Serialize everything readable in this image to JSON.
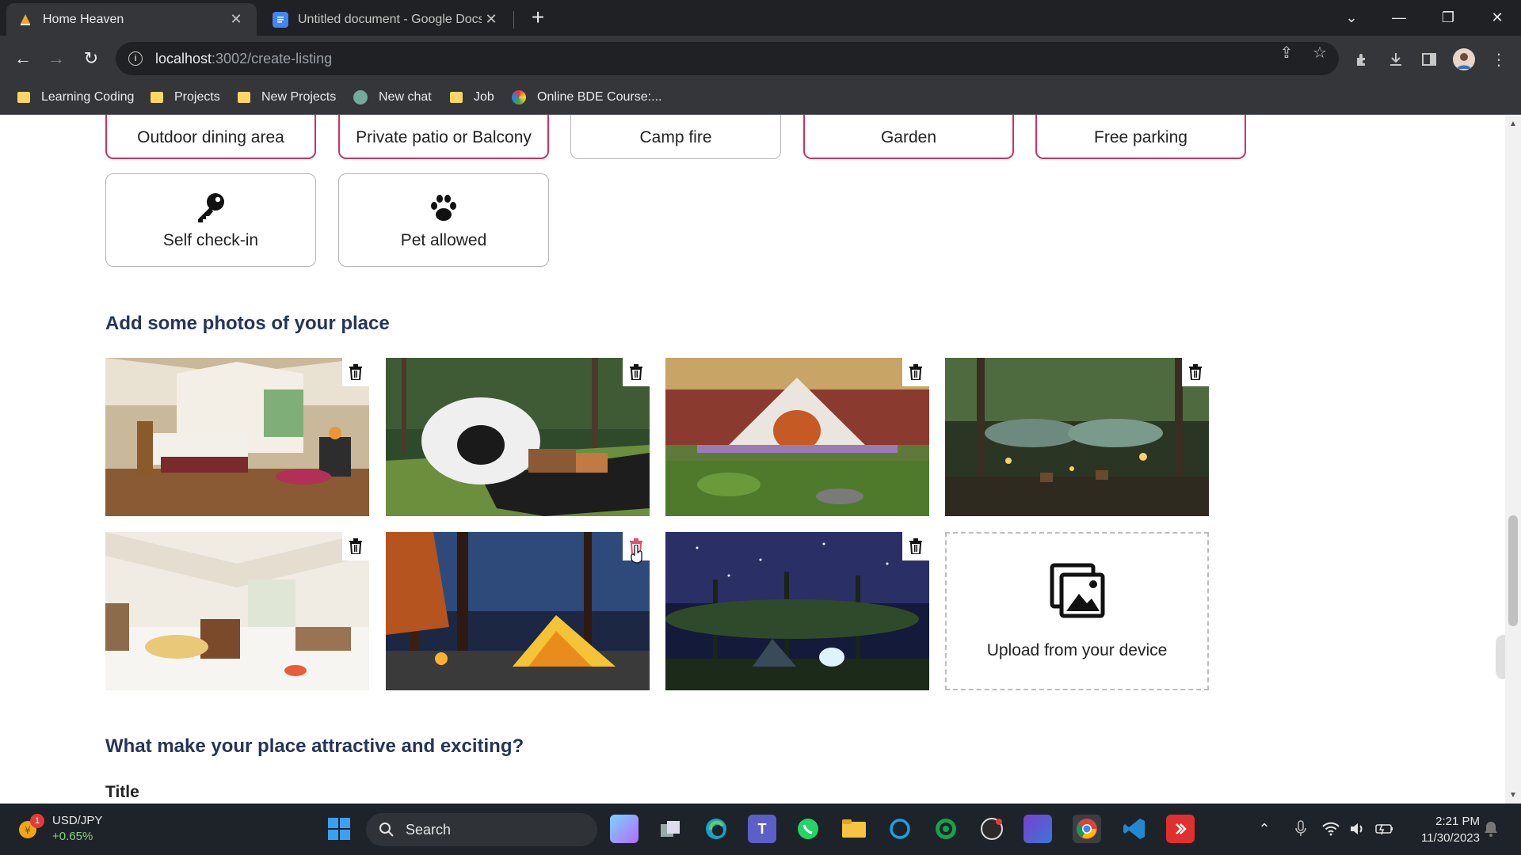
{
  "browser": {
    "tabs": [
      {
        "title": "Home Heaven",
        "active": true
      },
      {
        "title": "Untitled document - Google Docs",
        "active": false
      }
    ],
    "new_tab_label": "+",
    "url_host": "localhost",
    "url_path": ":3002/create-listing",
    "bookmarks": [
      {
        "label": "Learning Coding",
        "icon": "folder-icon"
      },
      {
        "label": "Projects",
        "icon": "folder-icon"
      },
      {
        "label": "New Projects",
        "icon": "folder-icon"
      },
      {
        "label": "New chat",
        "icon": "chatgpt-icon"
      },
      {
        "label": "Job",
        "icon": "folder-icon"
      },
      {
        "label": "Online BDE Course:...",
        "icon": "course-icon"
      }
    ]
  },
  "amenities_top_row": [
    {
      "label": "Outdoor dining area",
      "selected": true
    },
    {
      "label": "Private patio or Balcony",
      "selected": true
    },
    {
      "label": "Camp fire",
      "selected": false
    },
    {
      "label": "Garden",
      "selected": true
    },
    {
      "label": "Free parking",
      "selected": true
    }
  ],
  "amenities_row2": [
    {
      "label": "Self check-in",
      "icon": "key-icon",
      "selected": false
    },
    {
      "label": "Pet allowed",
      "icon": "paw-icon",
      "selected": false
    }
  ],
  "photos_section": {
    "heading": "Add some photos of your place",
    "photos": [
      {
        "alt": "tent-bedroom-photo"
      },
      {
        "alt": "dome-tent-photo"
      },
      {
        "alt": "bell-tent-garden-photo"
      },
      {
        "alt": "hammock-tents-photo"
      },
      {
        "alt": "bright-tent-interior-photo"
      },
      {
        "alt": "night-forest-tent-photo"
      },
      {
        "alt": "starry-sky-camp-photo"
      }
    ],
    "upload_label": "Upload from your device",
    "colors": {
      "hover_trash": "#e0506a"
    }
  },
  "details_section": {
    "heading": "What make your place attractive and exciting?",
    "title_label": "Title"
  },
  "taskbar": {
    "widget_ticker": "USD/JPY",
    "widget_change": "+0.65%",
    "widget_badge": "1",
    "search_placeholder": "Search",
    "time": "2:21 PM",
    "date": "11/30/2023"
  },
  "theme": {
    "accent": "#d1315d",
    "heading": "#24355a"
  }
}
